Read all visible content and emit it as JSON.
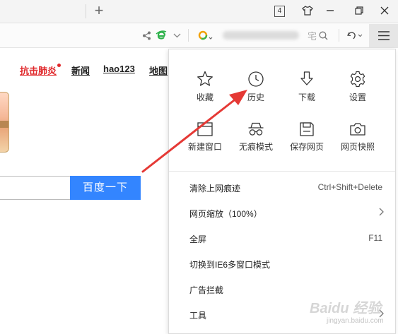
{
  "toolbar": {
    "tab_count": "4",
    "new_tab_glyph": "+",
    "search_tail_text": "宅",
    "icons": [
      "share-icon",
      "ie-mode-icon",
      "chevron-down-icon",
      "search-engine-icon",
      "search-icon",
      "undo-icon",
      "menu-icon",
      "skin-icon",
      "restore-icon",
      "close-icon"
    ]
  },
  "page": {
    "nav": [
      {
        "label": "抗击肺炎",
        "hot": true
      },
      {
        "label": "新闻"
      },
      {
        "label": "hao123"
      },
      {
        "label": "地图"
      }
    ],
    "search_button": "百度一下"
  },
  "menu": {
    "grid": [
      {
        "label": "收藏",
        "icon": "star-icon"
      },
      {
        "label": "历史",
        "icon": "clock-icon"
      },
      {
        "label": "下载",
        "icon": "download-icon"
      },
      {
        "label": "设置",
        "icon": "gear-icon"
      },
      {
        "label": "新建窗口",
        "icon": "new-window-icon"
      },
      {
        "label": "无痕模式",
        "icon": "incognito-icon"
      },
      {
        "label": "保存网页",
        "icon": "save-icon"
      },
      {
        "label": "网页快照",
        "icon": "camera-icon"
      }
    ],
    "items": [
      {
        "label": "清除上网痕迹",
        "shortcut": "Ctrl+Shift+Delete"
      },
      {
        "label": "网页缩放（100%）",
        "submenu": true
      },
      {
        "label": "全屏",
        "shortcut": "F11"
      },
      {
        "label": "切换到IE6多窗口模式"
      },
      {
        "label": "广告拦截"
      },
      {
        "label": "工具",
        "submenu": true
      }
    ]
  },
  "watermark": {
    "text": "Baidu 经验",
    "sub": "jingyan.baidu.com"
  },
  "colors": {
    "accent": "#3385ff",
    "hot": "#e0282b",
    "arrow": "#e53935"
  }
}
